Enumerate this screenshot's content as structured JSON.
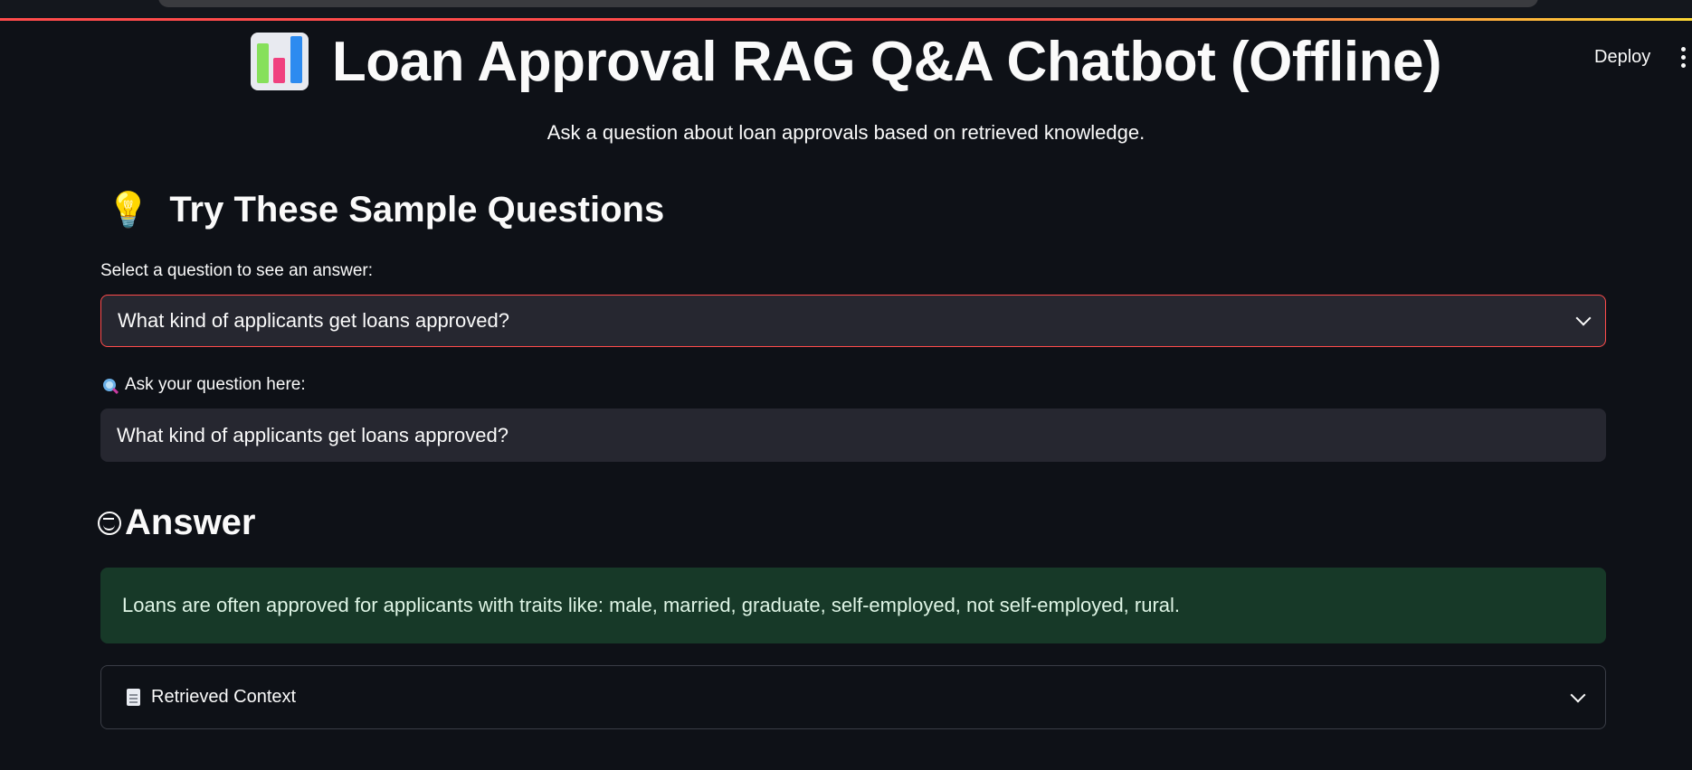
{
  "header": {
    "deploy_label": "Deploy",
    "menu_icon": "kebab-menu-icon"
  },
  "hero": {
    "icon": "bar-chart-icon",
    "title": "Loan Approval RAG Q&A Chatbot (Offline)",
    "subtitle": "Ask a question about loan approvals based on retrieved knowledge."
  },
  "samples": {
    "icon": "lightbulb-icon",
    "heading": "Try These Sample Questions",
    "select_label": "Select a question to see an answer:",
    "selected_value": "What kind of applicants get loans approved?"
  },
  "question": {
    "icon": "search-icon",
    "label": "Ask your question here:",
    "value": "What kind of applicants get loans approved?"
  },
  "answer": {
    "icon": "smile-icon",
    "heading": "Answer",
    "text": "Loans are often approved for applicants with traits like: male, married, graduate, self-employed, not self-employed, rural."
  },
  "context": {
    "icon": "document-icon",
    "label": "Retrieved Context"
  },
  "colors": {
    "background": "#0e1117",
    "accent": "#ff4b4b",
    "answer_bg": "#173928",
    "input_bg": "#262730"
  }
}
